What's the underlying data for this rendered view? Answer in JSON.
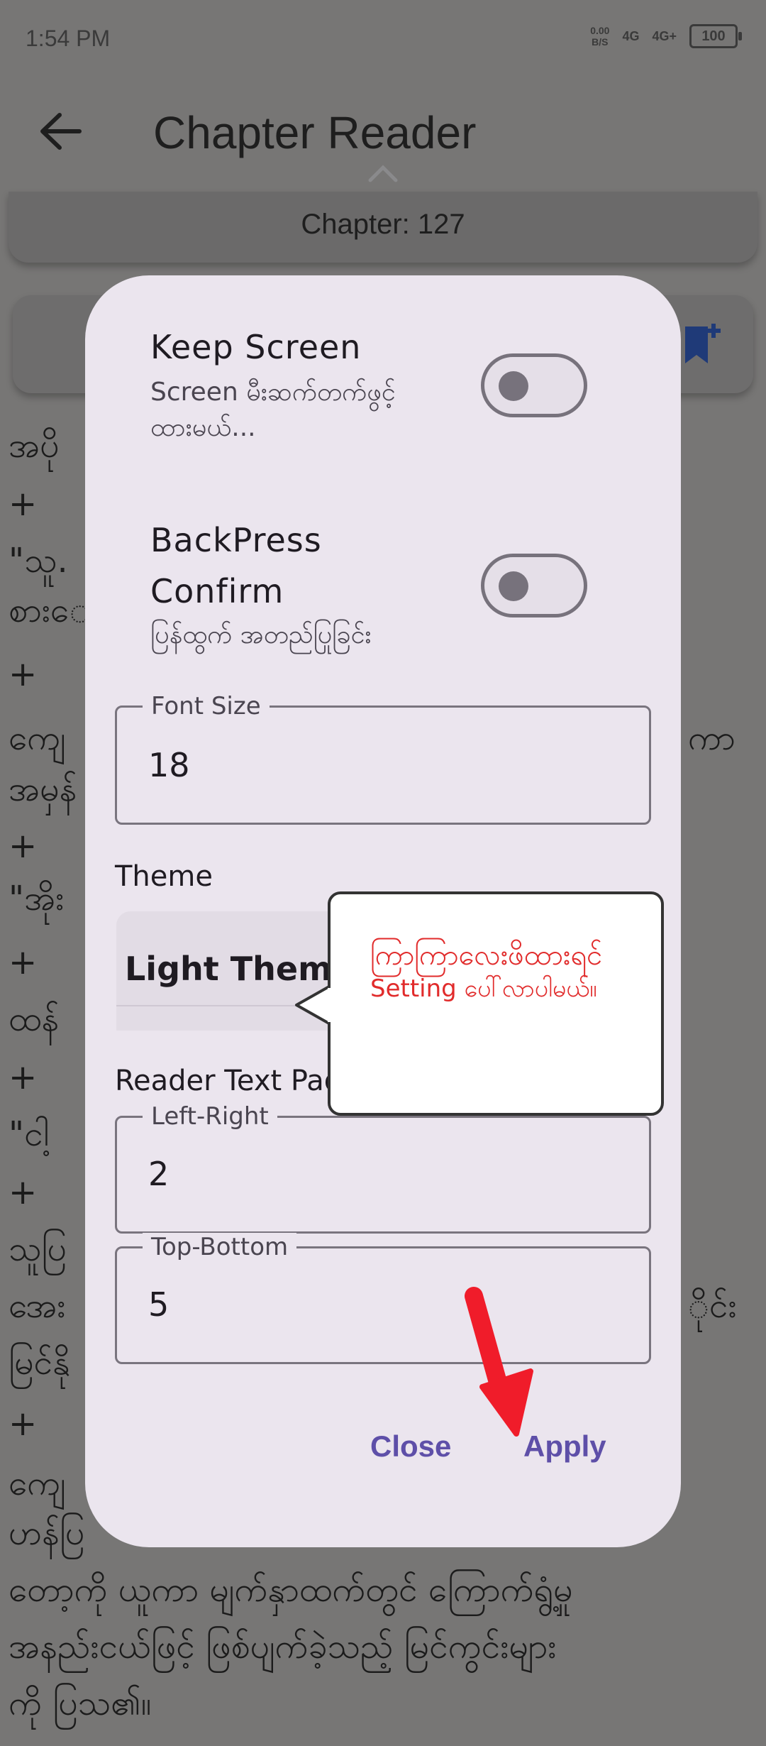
{
  "status_bar": {
    "time": "1:54 PM",
    "net_speed_value": "0.00",
    "net_speed_unit": "B/S",
    "signal_1": "4G",
    "signal_2": "4G+",
    "battery": "100"
  },
  "app_bar": {
    "title": "Chapter Reader",
    "chapter": "Chapter: 127"
  },
  "background_text": [
    "အပို",
    "+",
    "\"သူ.",
    "စားေ",
    "+",
    "ကျေ",
    "ကာ",
    "အမှန်",
    "+",
    "\"အိုး",
    "+",
    "ထန်",
    "+",
    "\"ငါ့",
    "+",
    "သူပြ",
    "အေး",
    "ိုင်း",
    "မြင်နို",
    "+",
    "ကျေ",
    "ဟန်ပြ",
    "တော့ကို ယူကာ မျက်နှာထက်တွင် ကြောက်ရွံ့မှု",
    "အနည်းငယ်ဖြင့် ဖြစ်ပျက်ခဲ့သည့် မြင်ကွင်းများ",
    "ကို ပြသ၏။"
  ],
  "dialog": {
    "keep_screen": {
      "title": "Keep Screen",
      "subtitle_1": "Screen မီးဆက်တက်ဖွင့်",
      "subtitle_2": "ထားမယ်..."
    },
    "backpress": {
      "title_1": "BackPress",
      "title_2": "Confirm",
      "subtitle": "ပြန်ထွက် အတည်ပြုခြင်း"
    },
    "font_size": {
      "label": "Font Size",
      "value": "18"
    },
    "theme": {
      "label": "Theme",
      "selected": "Light Theme"
    },
    "padding": {
      "label": "Reader Text Pad",
      "left_right_label": "Left-Right",
      "left_right_value": "2",
      "top_bottom_label": "Top-Bottom",
      "top_bottom_value": "5"
    },
    "close_label": "Close",
    "apply_label": "Apply"
  },
  "tooltip": {
    "line_1": "ကြာကြာလေးဖိထားရင်",
    "line_2": "Setting ပေါ်လာပါမယ်။"
  },
  "colors": {
    "scrim": "#777675",
    "dialog_bg": "#ebe5ee",
    "accent": "#5e4fa8",
    "annotation_red": "#e12b2b"
  }
}
